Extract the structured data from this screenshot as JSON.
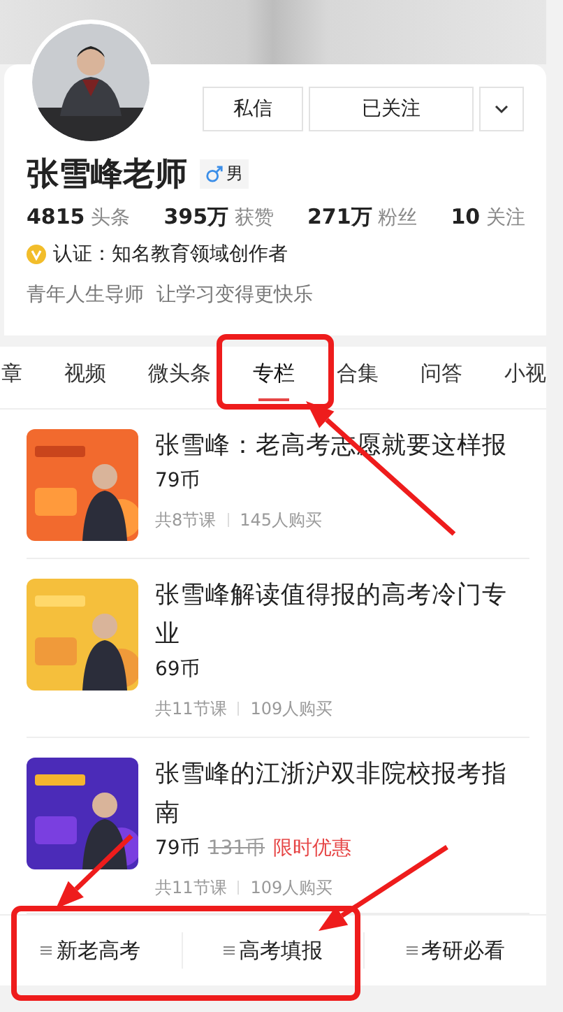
{
  "profile": {
    "name": "张雪峰老师",
    "gender": "男",
    "buttons": [
      {
        "label": "私信"
      },
      {
        "label": "已关注"
      }
    ],
    "stats": [
      "**4815** 头条",
      "**395万** 获赞",
      "**271万** 粉丝",
      "**10** 关注"
    ],
    "verified": "认证：知名教育领域创作者",
    "bio": "青年人生导师  让学习变得更快乐"
  },
  "tabs": [
    {
      "label": "章",
      "selected": false
    },
    {
      "label": "视频",
      "selected": false
    },
    {
      "label": "微头条",
      "selected": false
    },
    {
      "label": "专栏",
      "selected": true
    },
    {
      "label": "合集",
      "selected": false
    },
    {
      "label": "问答",
      "selected": false
    },
    {
      "label": "小视",
      "selected": false
    }
  ],
  "courses": [
    {
      "title": "张雪峰：老高考志愿就要这样报",
      "price": "79币",
      "lessons": "共8节课",
      "buyers": "145人购买"
    },
    {
      "title": "张雪峰解读值得报的高考冷门专业",
      "price": "69币",
      "lessons": "共11节课",
      "buyers": "109人购买"
    },
    {
      "title": "张雪峰的江浙沪双非院校报考指南",
      "price": "79币",
      "original_price": "131币",
      "promo": "限时优惠",
      "lessons": "共11节课",
      "buyers": "109人购买"
    }
  ],
  "bottom_menu": [
    {
      "label": "新老高考"
    },
    {
      "label": "高考填报"
    },
    {
      "label": "考研必看"
    }
  ],
  "annotations": [
    {
      "kind": "box"
    },
    {
      "kind": "arrow"
    },
    {
      "kind": "box"
    },
    {
      "kind": "arrow"
    },
    {
      "kind": "arrow"
    }
  ]
}
